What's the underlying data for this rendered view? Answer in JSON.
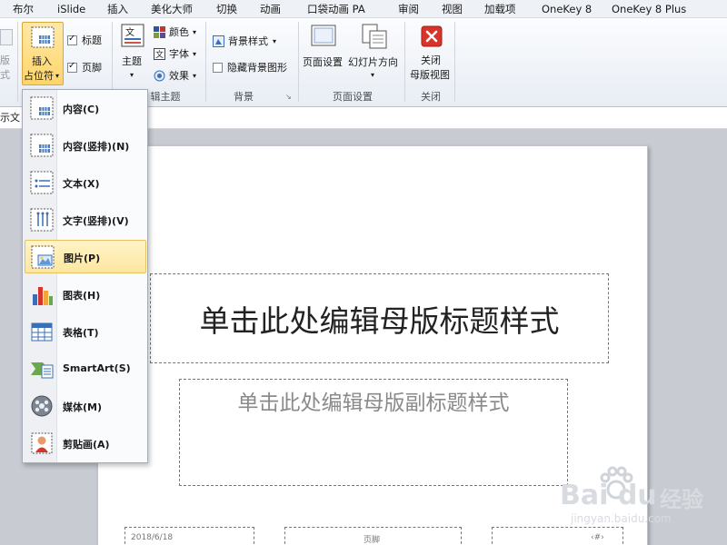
{
  "menubar": {
    "tabs": [
      "布尔",
      "iSlide",
      "插入",
      "美化大师",
      "切换",
      "动画",
      "口袋动画 PA",
      "审阅",
      "视图",
      "加载项",
      "OneKey 8",
      "OneKey 8 Plus"
    ]
  },
  "ribbon": {
    "cut_left_top": "版",
    "cut_left_bottom": "式",
    "insert_placeholder_line1": "插入",
    "insert_placeholder_line2": "占位符",
    "check_title": "标题",
    "check_footer": "页脚",
    "theme_label": "主题",
    "colors_label": "颜色",
    "fonts_label": "字体",
    "effects_label": "效果",
    "edit_theme_group": "辑主题",
    "bg_styles_label": "背景样式",
    "hide_bg_label": "隐藏背景图形",
    "background_group": "背景",
    "page_setup_label": "页面设置",
    "slide_orientation_label": "幻灯片方向",
    "page_setup_group": "页面设置",
    "close_line1": "关闭",
    "close_line2": "母版视图",
    "close_group": "关闭"
  },
  "strip": {
    "cut_text": "示文"
  },
  "dropdown": {
    "items": [
      {
        "label": "内容(C)",
        "icon": "content-placeholder-icon"
      },
      {
        "label": "内容(竖排)(N)",
        "icon": "vertical-content-placeholder-icon"
      },
      {
        "label": "文本(X)",
        "icon": "text-placeholder-icon"
      },
      {
        "label": "文字(竖排)(V)",
        "icon": "vertical-text-placeholder-icon"
      },
      {
        "label": "图片(P)",
        "icon": "picture-placeholder-icon"
      },
      {
        "label": "图表(H)",
        "icon": "chart-placeholder-icon"
      },
      {
        "label": "表格(T)",
        "icon": "table-placeholder-icon"
      },
      {
        "label": "SmartArt(S)",
        "icon": "smartart-placeholder-icon"
      },
      {
        "label": "媒体(M)",
        "icon": "media-placeholder-icon"
      },
      {
        "label": "剪贴画(A)",
        "icon": "clipart-placeholder-icon"
      }
    ]
  },
  "slide": {
    "title": "单击此处编辑母版标题样式",
    "subtitle": "单击此处编辑母版副标题样式",
    "date": "2018/6/18",
    "footer": "页脚",
    "slide_number": "‹#›"
  },
  "watermark": {
    "brand": "Bai du",
    "brand_cn": "经验",
    "url": "jingyan.baidu.com"
  },
  "colors": {
    "accent_highlight": "#fde6a0",
    "close_red": "#d9342b"
  }
}
